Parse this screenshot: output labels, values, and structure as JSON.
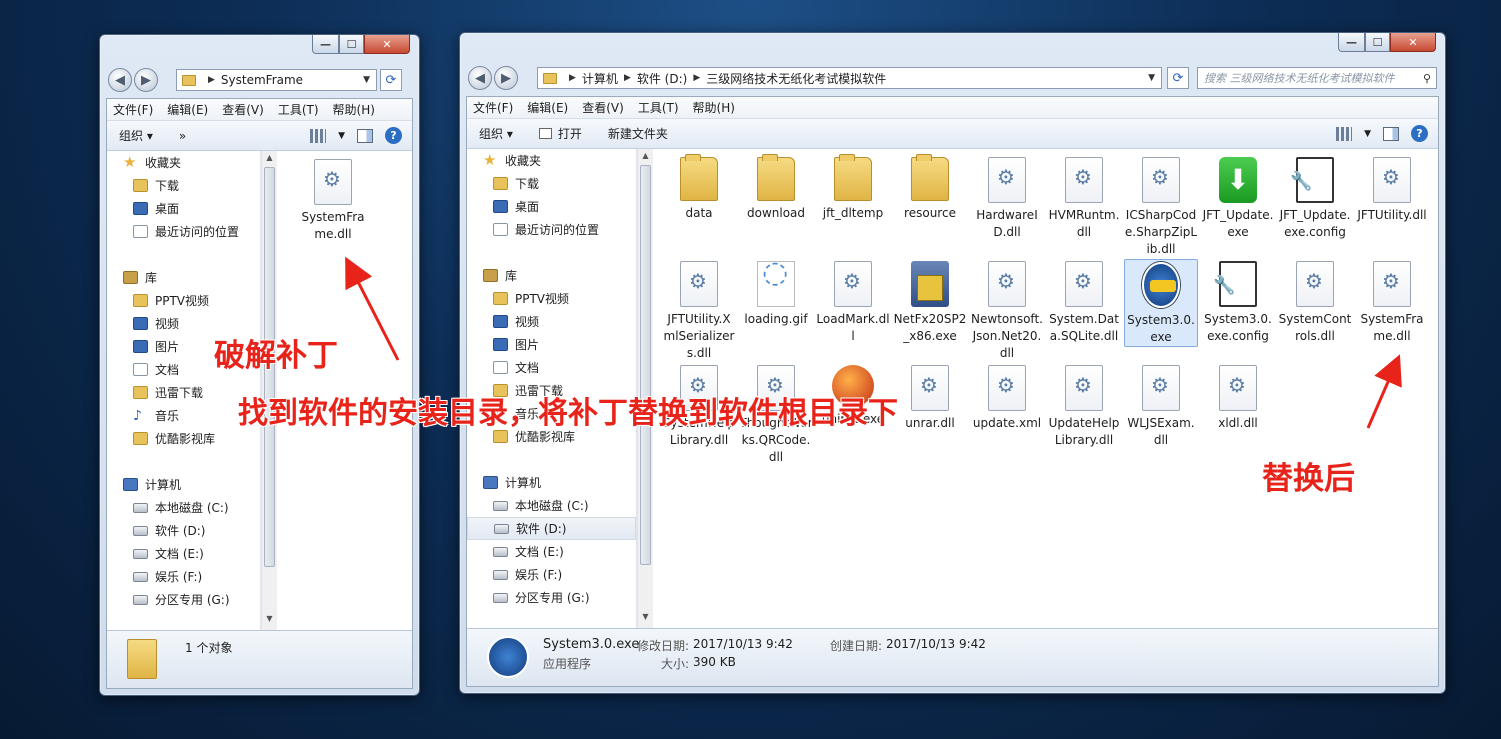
{
  "colors": {
    "accent": "#2d6ec5",
    "annotation": "#e8231a",
    "selection": "#d9e9fb"
  },
  "menu": [
    "文件(F)",
    "编辑(E)",
    "查看(V)",
    "工具(T)",
    "帮助(H)"
  ],
  "window1": {
    "address": "SystemFrame",
    "toolbar": {
      "organize": "组织 ▾",
      "more": "»"
    },
    "nav": [
      {
        "label": "收藏夹",
        "icon": "star-icon"
      },
      {
        "label": "下载",
        "icon": "download-folder-icon"
      },
      {
        "label": "桌面",
        "icon": "desktop-icon"
      },
      {
        "label": "最近访问的位置",
        "icon": "recent-icon"
      },
      {
        "label": "",
        "icon": ""
      },
      {
        "label": "库",
        "icon": "library-icon"
      },
      {
        "label": "PPTV视频",
        "icon": "library-folder-icon"
      },
      {
        "label": "视频",
        "icon": "video-icon"
      },
      {
        "label": "图片",
        "icon": "pictures-icon"
      },
      {
        "label": "文档",
        "icon": "documents-icon"
      },
      {
        "label": "迅雷下载",
        "icon": "library-folder-icon"
      },
      {
        "label": "音乐",
        "icon": "music-icon"
      },
      {
        "label": "优酷影视库",
        "icon": "library-folder-icon"
      },
      {
        "label": "",
        "icon": ""
      },
      {
        "label": "计算机",
        "icon": "computer-icon"
      },
      {
        "label": "本地磁盘 (C:)",
        "icon": "drive-icon"
      },
      {
        "label": "软件 (D:)",
        "icon": "drive-icon"
      },
      {
        "label": "文档 (E:)",
        "icon": "drive-icon"
      },
      {
        "label": "娱乐 (F:)",
        "icon": "drive-icon"
      },
      {
        "label": "分区专用 (G:)",
        "icon": "drive-icon"
      }
    ],
    "files": [
      {
        "name": "SystemFrame.dll",
        "type": "dll"
      }
    ],
    "status": "1 个对象"
  },
  "window2": {
    "address": [
      "计算机",
      "软件 (D:)",
      "三级网络技术无纸化考试模拟软件"
    ],
    "search_placeholder": "搜索 三级网络技术无纸化考试模拟软件",
    "toolbar": {
      "organize": "组织 ▾",
      "open": "打开",
      "new_folder": "新建文件夹"
    },
    "nav": [
      {
        "label": "收藏夹",
        "icon": "star-icon"
      },
      {
        "label": "下载",
        "icon": "download-folder-icon"
      },
      {
        "label": "桌面",
        "icon": "desktop-icon"
      },
      {
        "label": "最近访问的位置",
        "icon": "recent-icon"
      },
      {
        "label": "",
        "icon": ""
      },
      {
        "label": "库",
        "icon": "library-icon"
      },
      {
        "label": "PPTV视频",
        "icon": "library-folder-icon"
      },
      {
        "label": "视频",
        "icon": "video-icon"
      },
      {
        "label": "图片",
        "icon": "pictures-icon"
      },
      {
        "label": "文档",
        "icon": "documents-icon"
      },
      {
        "label": "迅雷下载",
        "icon": "library-folder-icon"
      },
      {
        "label": "音乐",
        "icon": "music-icon"
      },
      {
        "label": "优酷影视库",
        "icon": "library-folder-icon"
      },
      {
        "label": "",
        "icon": ""
      },
      {
        "label": "计算机",
        "icon": "computer-icon"
      },
      {
        "label": "本地磁盘 (C:)",
        "icon": "drive-icon"
      },
      {
        "label": "软件 (D:)",
        "icon": "drive-icon",
        "selected": true
      },
      {
        "label": "文档 (E:)",
        "icon": "drive-icon"
      },
      {
        "label": "娱乐 (F:)",
        "icon": "drive-icon"
      },
      {
        "label": "分区专用 (G:)",
        "icon": "drive-icon"
      }
    ],
    "files": [
      {
        "name": "data",
        "type": "fold"
      },
      {
        "name": "download",
        "type": "fold"
      },
      {
        "name": "jft_dltemp",
        "type": "fold"
      },
      {
        "name": "resource",
        "type": "fold"
      },
      {
        "name": "HardwareID.dll",
        "type": "dll"
      },
      {
        "name": "HVMRuntm.dll",
        "type": "dll"
      },
      {
        "name": "ICSharpCode.SharpZipLib.dll",
        "type": "dll"
      },
      {
        "name": "JFT_Update.exe",
        "type": "green"
      },
      {
        "name": "JFT_Update.exe.config",
        "type": "cfg"
      },
      {
        "name": "JFTUtility.dll",
        "type": "dll"
      },
      {
        "name": "JFTUtility.XmlSerializers.dll",
        "type": "dll"
      },
      {
        "name": "loading.gif",
        "type": "gif"
      },
      {
        "name": "LoadMark.dll",
        "type": "dll"
      },
      {
        "name": "NetFx20SP2_x86.exe",
        "type": "exe"
      },
      {
        "name": "Newtonsoft.Json.Net20.dll",
        "type": "dll"
      },
      {
        "name": "System.Data.SQLite.dll",
        "type": "dll"
      },
      {
        "name": "System3.0.exe",
        "type": "logo",
        "selected": true
      },
      {
        "name": "System3.0.exe.config",
        "type": "cfg"
      },
      {
        "name": "SystemControls.dll",
        "type": "dll"
      },
      {
        "name": "SystemFrame.dll",
        "type": "dll"
      },
      {
        "name": "SystemHelpLibrary.dll",
        "type": "dll"
      },
      {
        "name": "ThoughtWorks.QRCode.dll",
        "type": "dll"
      },
      {
        "name": "uninst.exe",
        "type": "ball"
      },
      {
        "name": "unrar.dll",
        "type": "dll"
      },
      {
        "name": "update.xml",
        "type": "dll"
      },
      {
        "name": "UpdateHelpLibrary.dll",
        "type": "dll"
      },
      {
        "name": "WLJSExam.dll",
        "type": "dll"
      },
      {
        "name": "xldl.dll",
        "type": "dll"
      }
    ],
    "status": {
      "name": "System3.0.exe",
      "type": "应用程序",
      "modified_label": "修改日期:",
      "modified": "2017/10/13 9:42",
      "created_label": "创建日期:",
      "created": "2017/10/13 9:42",
      "size_label": "大小:",
      "size": "390 KB"
    }
  },
  "annotations": {
    "crack_patch": "破解补丁",
    "instruction": "找到软件的安装目录，将补丁替换到软件根目录下",
    "after_replace": "替换后"
  }
}
